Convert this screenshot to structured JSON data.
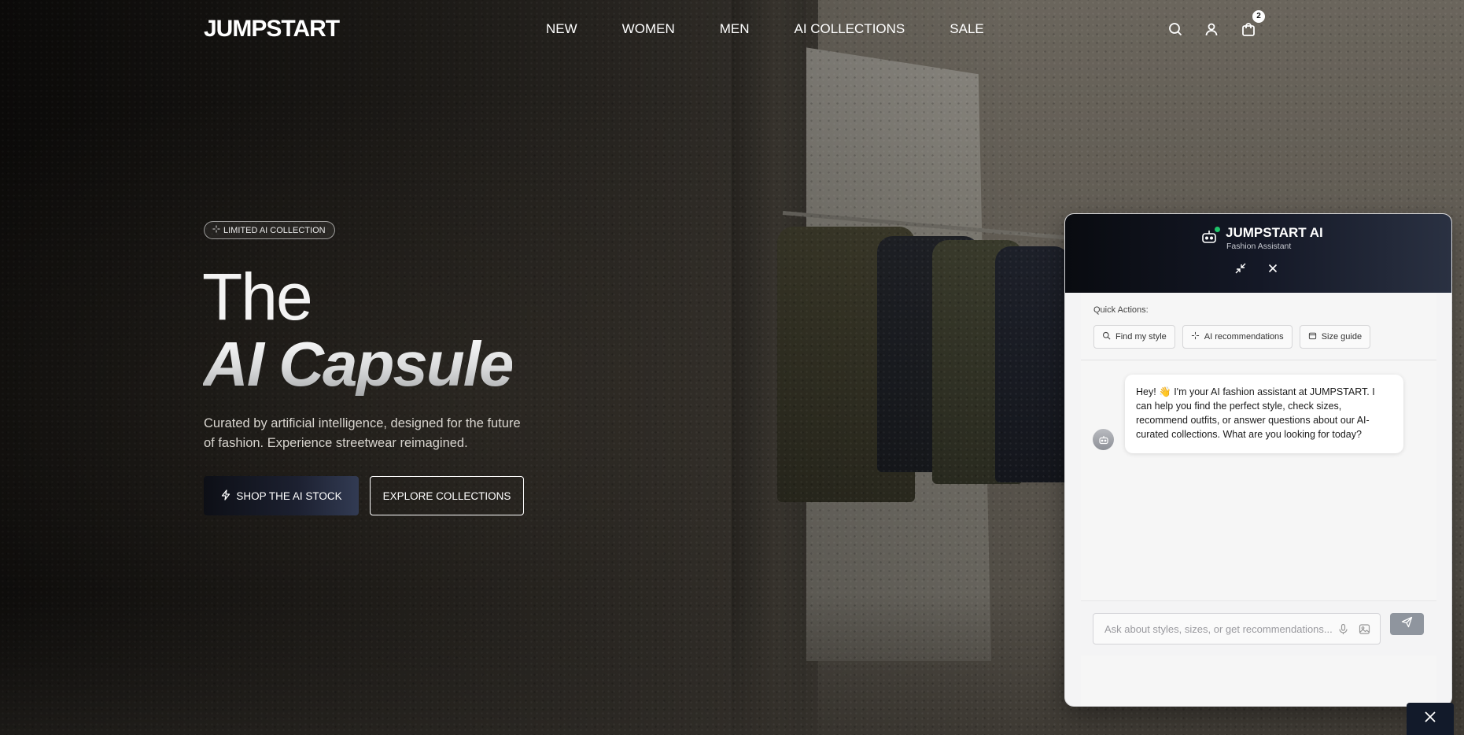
{
  "brand": {
    "logo": "JUMPSTART"
  },
  "nav": {
    "items": [
      {
        "label": "NEW"
      },
      {
        "label": "WOMEN"
      },
      {
        "label": "MEN"
      },
      {
        "label": "AI COLLECTIONS"
      },
      {
        "label": "SALE"
      }
    ]
  },
  "header_icons": {
    "search": "search-icon",
    "account": "user-icon",
    "cart": "shopping-bag-icon",
    "cart_count": "2"
  },
  "hero": {
    "badge": "LIMITED AI COLLECTION",
    "title_line1": "The",
    "title_line2": "AI Capsule",
    "description": "Curated by artificial intelligence, designed for the future of fashion. Experience streetwear reimagined.",
    "primary_cta": "SHOP THE AI STOCK",
    "secondary_cta": "EXPLORE COLLECTIONS"
  },
  "chat": {
    "title": "JUMPSTART AI",
    "subtitle": "Fashion Assistant",
    "quick_actions_label": "Quick Actions:",
    "quick_actions": [
      {
        "label": "Find my style",
        "icon": "search-icon"
      },
      {
        "label": "AI recommendations",
        "icon": "sparkles-icon"
      },
      {
        "label": "Size guide",
        "icon": "ruler-icon"
      }
    ],
    "messages": [
      {
        "from": "assistant",
        "text": "Hey! 👋 I'm your AI fashion assistant at JUMPSTART. I can help you find the perfect style, check sizes, recommend outfits, or answer questions about our AI-curated collections. What are you looking for today?"
      }
    ],
    "input_placeholder": "Ask about styles, sizes, or get recommendations...",
    "input_value": ""
  },
  "colors": {
    "chat_header_start": "#090b10",
    "chat_header_end": "#2a3142",
    "online": "#1fc46a",
    "send_button": "#8f959e",
    "primary_btn_end": "#323b53"
  }
}
